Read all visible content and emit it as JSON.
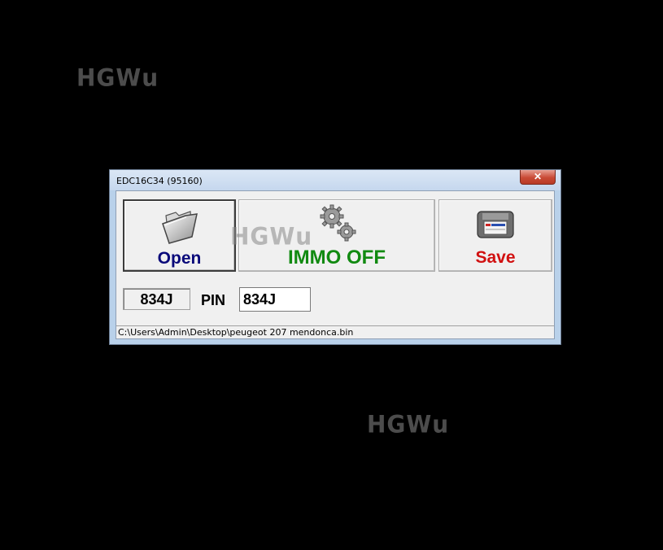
{
  "watermark": {
    "text": "HGWu"
  },
  "window": {
    "title": "EDC16C34 (95160)",
    "close_symbol": "✕"
  },
  "toolbar": {
    "open_label": "Open",
    "immo_label": "IMMO OFF",
    "save_label": "Save"
  },
  "fields": {
    "code_value": "834J",
    "pin_label": "PIN",
    "pin_value": "834J"
  },
  "status": {
    "path": "C:\\Users\\Admin\\Desktop\\peugeot 207 mendonca.bin"
  },
  "colors": {
    "open": "#0a0a7a",
    "immo": "#118a11",
    "save": "#d11010",
    "close": "#c94a35"
  },
  "icons": {
    "open": "folder-icon",
    "immo": "gears-icon",
    "save": "floppy-disk-icon",
    "close": "close-icon"
  }
}
